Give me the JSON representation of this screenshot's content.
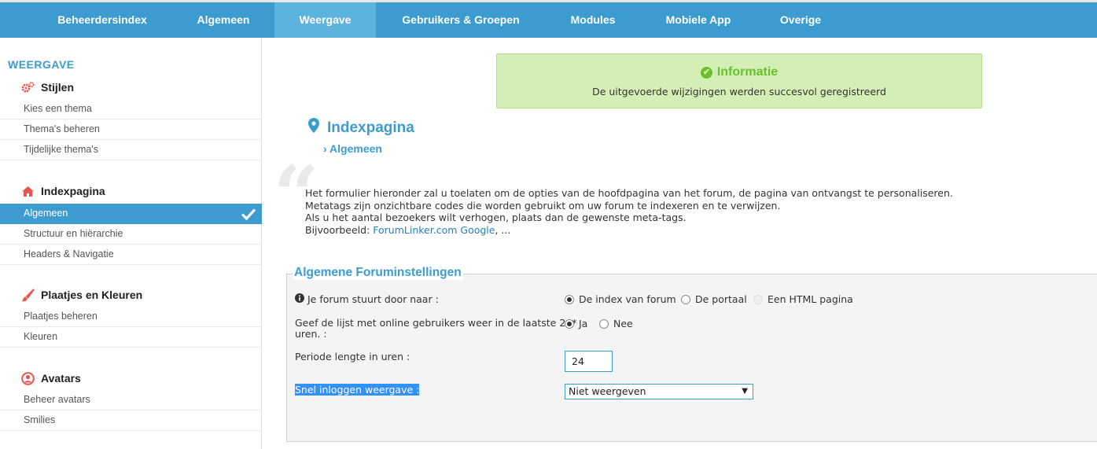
{
  "topnav": {
    "tabs": [
      {
        "label": "Beheerdersindex"
      },
      {
        "label": "Algemeen"
      },
      {
        "label": "Weergave"
      },
      {
        "label": "Gebruikers & Groepen"
      },
      {
        "label": "Modules"
      },
      {
        "label": "Mobiele App"
      },
      {
        "label": "Overige"
      }
    ],
    "active_tab": "Weergave"
  },
  "sidebar": {
    "title": "WEERGAVE",
    "sections": [
      {
        "label": "Stijlen",
        "icon": "gears-icon",
        "items": [
          "Kies een thema",
          "Thema's beheren",
          "Tijdelijke thema's"
        ]
      },
      {
        "label": "Indexpagina",
        "icon": "home-icon",
        "items": [
          "Algemeen",
          "Structuur en hiërarchie",
          "Headers & Navigatie"
        ]
      },
      {
        "label": "Plaatjes en Kleuren",
        "icon": "paintbrush-icon",
        "items": [
          "Plaatjes beheren",
          "Kleuren"
        ]
      },
      {
        "label": "Avatars",
        "icon": "user-circle-icon",
        "items": [
          "Beheer avatars",
          "Smilies"
        ]
      }
    ],
    "active_item": "Algemeen"
  },
  "info": {
    "title": "Informatie",
    "message": "De uitgevoerde wijzigingen werden succesvol geregistreerd"
  },
  "page": {
    "title": "Indexpagina",
    "breadcrumb": "Algemeen"
  },
  "intro": {
    "line1": "Het formulier hieronder zal u toelaten om de opties van de hoofdpagina van het forum, de pagina van ontvangst te personaliseren.",
    "line2": "Metatags zijn onzichtbare codes die worden gebruikt om uw forum te indexeren en te verwijzen.",
    "line3": "Als u het aantal bezoekers wilt verhogen, plaats dan de gewenste meta-tags.",
    "line4_prefix": "Bijvoorbeeld: ",
    "link1": "ForumLinker.com",
    "link2": "Google",
    "line4_suffix": ", ..."
  },
  "form": {
    "legend": "Algemene Foruminstellingen",
    "redirect": {
      "label": "Je forum stuurt door naar :",
      "options": [
        "De index van forum",
        "De portaal",
        "Een HTML pagina"
      ],
      "selected": "De index van forum"
    },
    "online_list": {
      "label_line1": "Geef de lijst met online gebruikers weer in de laatste 24*",
      "label_line2": "uren. :",
      "options": [
        "Ja",
        "Nee"
      ],
      "selected": "Ja"
    },
    "period": {
      "label": "Periode lengte in uren :",
      "value": "24"
    },
    "quick_login": {
      "label": "Snel inloggen weergave :",
      "selected": "Niet weergeven"
    }
  },
  "colors": {
    "primary": "#3d9ccf",
    "active_tab": "#5eb2de",
    "success_bg": "#d3efb5",
    "success_text": "#6bbf2e"
  }
}
